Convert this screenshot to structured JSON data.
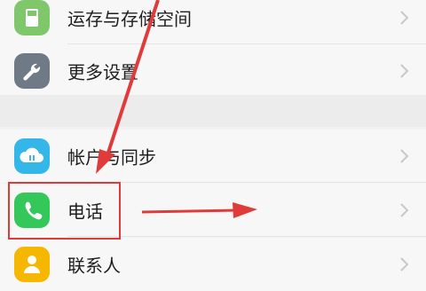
{
  "settings_items": [
    {
      "label": "运存与存储空间",
      "icon": "storage-icon",
      "color": "#7fc76a"
    },
    {
      "label": "更多设置",
      "icon": "wrench-icon",
      "color": "#6f7a86"
    },
    {
      "label": "帐户与同步",
      "icon": "cloud-sync-icon",
      "color": "#34b6e8"
    },
    {
      "label": "电话",
      "icon": "phone-icon",
      "color": "#34c759"
    },
    {
      "label": "联系人",
      "icon": "contacts-icon",
      "color": "#f5b700"
    }
  ],
  "annotation": {
    "color": "#e03b3b",
    "target": "电话"
  }
}
